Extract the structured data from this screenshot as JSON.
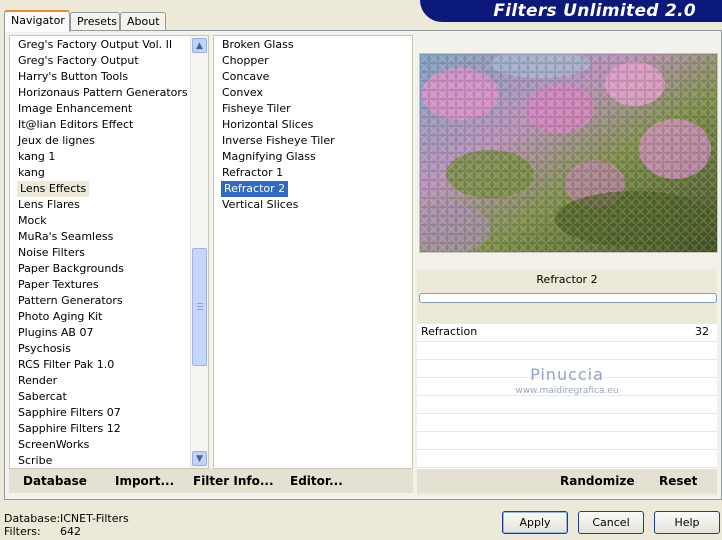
{
  "app": {
    "brand": "Filters Unlimited 2.0"
  },
  "tabs": [
    {
      "label": "Navigator",
      "active": true
    },
    {
      "label": "Presets",
      "active": false
    },
    {
      "label": "About",
      "active": false
    }
  ],
  "categories": {
    "items": [
      "Greg's Factory Output Vol. II",
      "Greg's Factory Output",
      "Harry's Button Tools",
      "Horizonaus Pattern Generators",
      "Image Enhancement",
      "It@lian Editors Effect",
      "Jeux de lignes",
      "kang 1",
      "kang",
      "Lens Effects",
      "Lens Flares",
      "Mock",
      "MuRa's Seamless",
      "Noise Filters",
      "Paper Backgrounds",
      "Paper Textures",
      "Pattern Generators",
      "Photo Aging Kit",
      "Plugins AB 07",
      "Psychosis",
      "RCS Filter Pak 1.0",
      "Render",
      "Sabercat",
      "Sapphire Filters 07",
      "Sapphire Filters 12",
      "ScreenWorks",
      "Scribe"
    ],
    "selected": "Lens Effects"
  },
  "filters": {
    "items": [
      "Broken Glass",
      "Chopper",
      "Concave",
      "Convex",
      "Fisheye Tiler",
      "Horizontal Slices",
      "Inverse Fisheye Tiler",
      "Magnifying Glass",
      "Refractor 1",
      "Refractor 2",
      "Vertical Slices"
    ],
    "selected": "Refractor 2"
  },
  "filter_panel": {
    "title": "Refractor 2",
    "params": [
      {
        "label": "Refraction",
        "value": "32"
      }
    ]
  },
  "watermark": {
    "name": "Pinuccia",
    "site": "www.maidiregrafica.eu"
  },
  "left_actions": {
    "database": "Database",
    "import": "Import...",
    "filter_info": "Filter Info...",
    "editor": "Editor..."
  },
  "right_actions": {
    "randomize": "Randomize",
    "reset": "Reset"
  },
  "footer": {
    "database_label": "Database:",
    "database_value": "ICNET-Filters",
    "filters_label": "Filters:",
    "filters_value": "642"
  },
  "buttons": {
    "apply": "Apply",
    "cancel": "Cancel",
    "help": "Help"
  }
}
